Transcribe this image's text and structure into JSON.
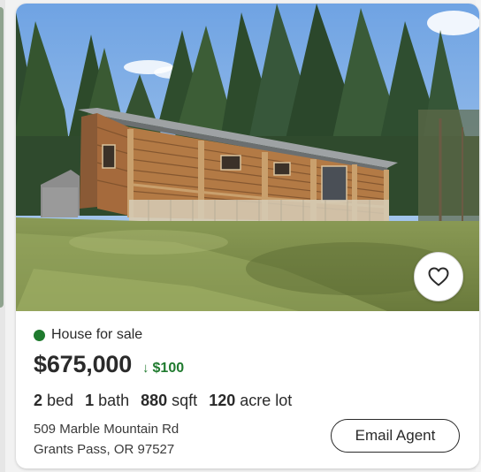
{
  "listing": {
    "status": "House for sale",
    "price": "$675,000",
    "price_change": "$100",
    "facts": {
      "beds_value": "2",
      "beds_label": "bed",
      "baths_value": "1",
      "baths_label": "bath",
      "sqft_value": "880",
      "sqft_label": "sqft",
      "lot_value": "120",
      "lot_label": "acre lot"
    },
    "address_line1": "509 Marble Mountain Rd",
    "address_line2": "Grants Pass, OR 97527"
  },
  "actions": {
    "email_agent_label": "Email Agent",
    "favorite_icon": "heart-icon"
  },
  "colors": {
    "status_dot": "#1f7a2e",
    "price_change": "#1f7a2e",
    "text_primary": "#2a2a2a"
  }
}
